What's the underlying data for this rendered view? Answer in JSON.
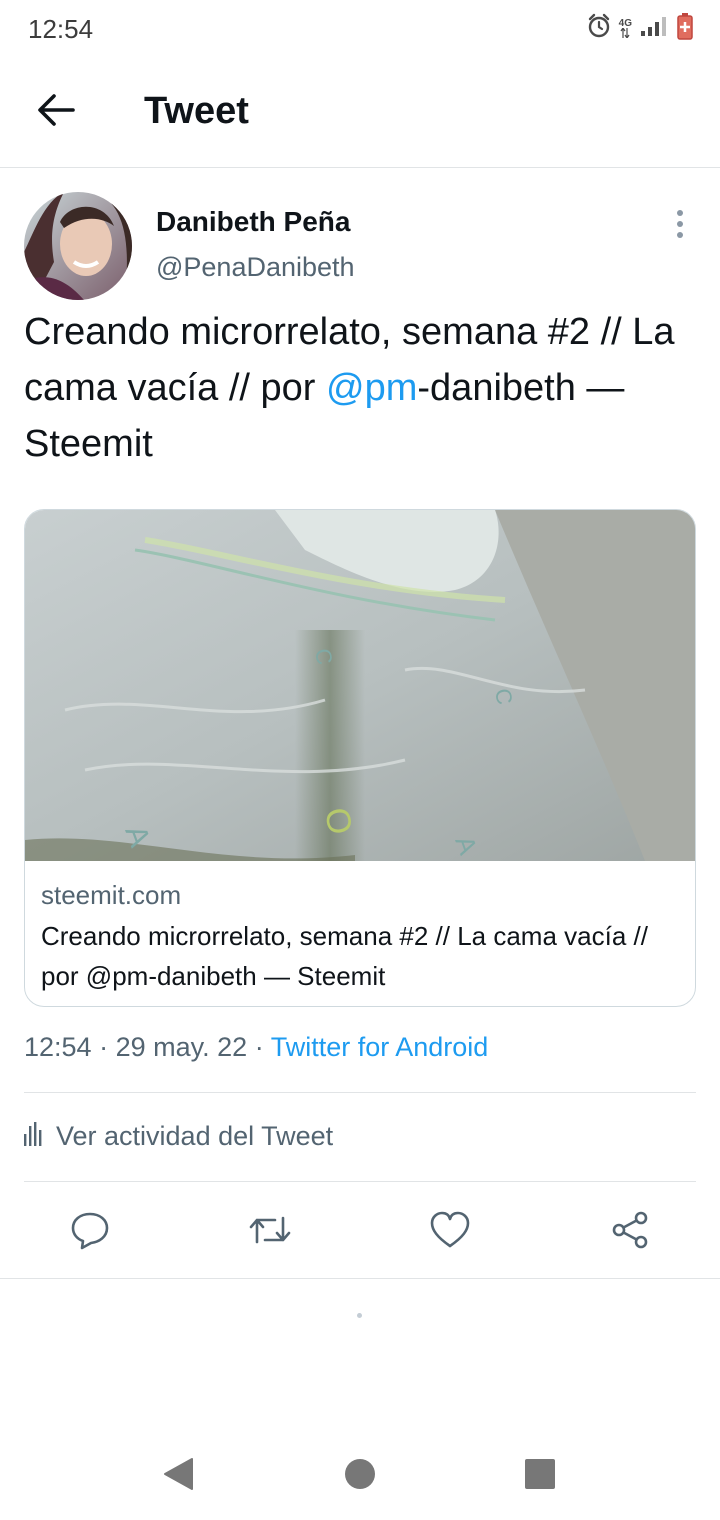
{
  "status_bar": {
    "time": "12:54",
    "network": "4G",
    "icons": [
      "alarm-icon",
      "network-4g-icon",
      "signal-icon",
      "battery-icon"
    ]
  },
  "header": {
    "title": "Tweet",
    "back_icon": "arrow-left-icon"
  },
  "tweet": {
    "author_name": "Danibeth Peña",
    "author_handle": "@PenaDanibeth",
    "text_part1": "Creando microrrelato, semana #2 // La cama vacía // por ",
    "mention": "@pm",
    "text_part2": "-danibeth — Steemit",
    "card": {
      "domain": "steemit.com",
      "title": "Creando microrrelato, semana #2 // La cama vacía // por @pm-danibeth — Steemit"
    },
    "time": "12:54",
    "date": "29 may. 22",
    "separator": "·",
    "source": "Twitter for Android",
    "activity_label": "Ver actividad del Tweet"
  },
  "actions": [
    "reply-icon",
    "retweet-icon",
    "like-icon",
    "share-icon"
  ],
  "colors": {
    "accent": "#1d9bf0",
    "text_primary": "#0f1419",
    "text_secondary": "#536471",
    "border": "#cfd9de"
  }
}
